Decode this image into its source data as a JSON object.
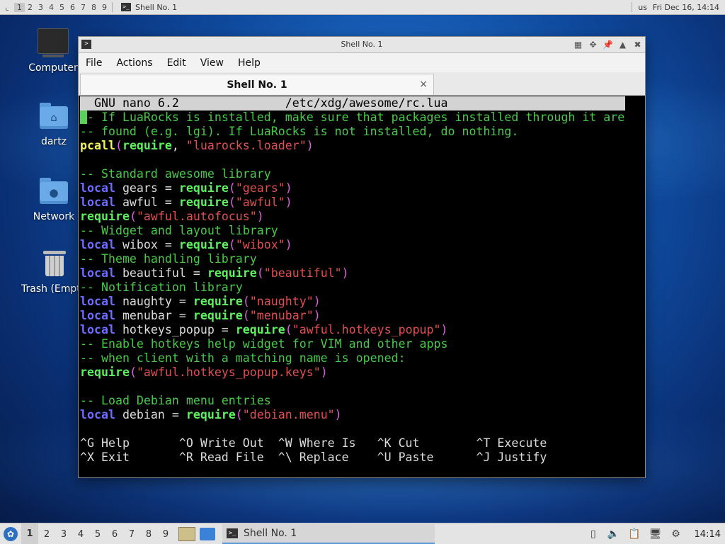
{
  "top_panel": {
    "workspaces": [
      "1",
      "2",
      "3",
      "4",
      "5",
      "6",
      "7",
      "8",
      "9"
    ],
    "task_title": "Shell No. 1",
    "keyboard_layout": "us",
    "datetime": "Fri Dec 16, 14:14"
  },
  "desktop": {
    "icons": [
      {
        "label": "Computer"
      },
      {
        "label": "dartz"
      },
      {
        "label": "Network"
      },
      {
        "label": "Trash (Empty)"
      }
    ]
  },
  "window": {
    "title": "Shell No. 1",
    "menu": [
      "File",
      "Actions",
      "Edit",
      "View",
      "Help"
    ],
    "tab_label": "Shell No. 1",
    "tab_close": "×"
  },
  "nano": {
    "version": "GNU nano 6.2",
    "file_path": "/etc/xdg/awesome/rc.lua",
    "lines": [
      [
        {
          "c": "cur",
          "t": "-"
        },
        {
          "c": "cm",
          "t": "- If LuaRocks is installed, make sure that packages installed through it are"
        }
      ],
      [
        {
          "c": "cm",
          "t": "-- found (e.g. lgi). If LuaRocks is not installed, do nothing."
        }
      ],
      [
        {
          "c": "fn",
          "t": "pcall"
        },
        {
          "c": "par",
          "t": "("
        },
        {
          "c": "req",
          "t": "require"
        },
        {
          "c": "txt",
          "t": ", "
        },
        {
          "c": "str",
          "t": "\"luarocks.loader\""
        },
        {
          "c": "par",
          "t": ")"
        }
      ],
      [],
      [
        {
          "c": "cm",
          "t": "-- Standard awesome library"
        }
      ],
      [
        {
          "c": "kw",
          "t": "local"
        },
        {
          "c": "txt",
          "t": " gears = "
        },
        {
          "c": "req",
          "t": "require"
        },
        {
          "c": "par",
          "t": "("
        },
        {
          "c": "str",
          "t": "\"gears\""
        },
        {
          "c": "par",
          "t": ")"
        }
      ],
      [
        {
          "c": "kw",
          "t": "local"
        },
        {
          "c": "txt",
          "t": " awful = "
        },
        {
          "c": "req",
          "t": "require"
        },
        {
          "c": "par",
          "t": "("
        },
        {
          "c": "str",
          "t": "\"awful\""
        },
        {
          "c": "par",
          "t": ")"
        }
      ],
      [
        {
          "c": "req",
          "t": "require"
        },
        {
          "c": "par",
          "t": "("
        },
        {
          "c": "str",
          "t": "\"awful.autofocus\""
        },
        {
          "c": "par",
          "t": ")"
        }
      ],
      [
        {
          "c": "cm",
          "t": "-- Widget and layout library"
        }
      ],
      [
        {
          "c": "kw",
          "t": "local"
        },
        {
          "c": "txt",
          "t": " wibox = "
        },
        {
          "c": "req",
          "t": "require"
        },
        {
          "c": "par",
          "t": "("
        },
        {
          "c": "str",
          "t": "\"wibox\""
        },
        {
          "c": "par",
          "t": ")"
        }
      ],
      [
        {
          "c": "cm",
          "t": "-- Theme handling library"
        }
      ],
      [
        {
          "c": "kw",
          "t": "local"
        },
        {
          "c": "txt",
          "t": " beautiful = "
        },
        {
          "c": "req",
          "t": "require"
        },
        {
          "c": "par",
          "t": "("
        },
        {
          "c": "str",
          "t": "\"beautiful\""
        },
        {
          "c": "par",
          "t": ")"
        }
      ],
      [
        {
          "c": "cm",
          "t": "-- Notification library"
        }
      ],
      [
        {
          "c": "kw",
          "t": "local"
        },
        {
          "c": "txt",
          "t": " naughty = "
        },
        {
          "c": "req",
          "t": "require"
        },
        {
          "c": "par",
          "t": "("
        },
        {
          "c": "str",
          "t": "\"naughty\""
        },
        {
          "c": "par",
          "t": ")"
        }
      ],
      [
        {
          "c": "kw",
          "t": "local"
        },
        {
          "c": "txt",
          "t": " menubar = "
        },
        {
          "c": "req",
          "t": "require"
        },
        {
          "c": "par",
          "t": "("
        },
        {
          "c": "str",
          "t": "\"menubar\""
        },
        {
          "c": "par",
          "t": ")"
        }
      ],
      [
        {
          "c": "kw",
          "t": "local"
        },
        {
          "c": "txt",
          "t": " hotkeys_popup = "
        },
        {
          "c": "req",
          "t": "require"
        },
        {
          "c": "par",
          "t": "("
        },
        {
          "c": "str",
          "t": "\"awful.hotkeys_popup\""
        },
        {
          "c": "par",
          "t": ")"
        }
      ],
      [
        {
          "c": "cm",
          "t": "-- Enable hotkeys help widget for VIM and other apps"
        }
      ],
      [
        {
          "c": "cm",
          "t": "-- when client with a matching name is opened:"
        }
      ],
      [
        {
          "c": "req",
          "t": "require"
        },
        {
          "c": "par",
          "t": "("
        },
        {
          "c": "str",
          "t": "\"awful.hotkeys_popup.keys\""
        },
        {
          "c": "par",
          "t": ")"
        }
      ],
      [],
      [
        {
          "c": "cm",
          "t": "-- Load Debian menu entries"
        }
      ],
      [
        {
          "c": "kw",
          "t": "local"
        },
        {
          "c": "txt",
          "t": " debian = "
        },
        {
          "c": "req",
          "t": "require"
        },
        {
          "c": "par",
          "t": "("
        },
        {
          "c": "str",
          "t": "\"debian.menu\""
        },
        {
          "c": "par",
          "t": ")"
        }
      ]
    ],
    "shortcuts_row1": "^G Help       ^O Write Out  ^W Where Is   ^K Cut        ^T Execute",
    "shortcuts_row2": "^X Exit       ^R Read File  ^\\ Replace    ^U Paste      ^J Justify"
  },
  "bottom_panel": {
    "workspaces": [
      "1",
      "2",
      "3",
      "4",
      "5",
      "6",
      "7",
      "8",
      "9"
    ],
    "task_title": "Shell No. 1",
    "clock": "14:14"
  }
}
